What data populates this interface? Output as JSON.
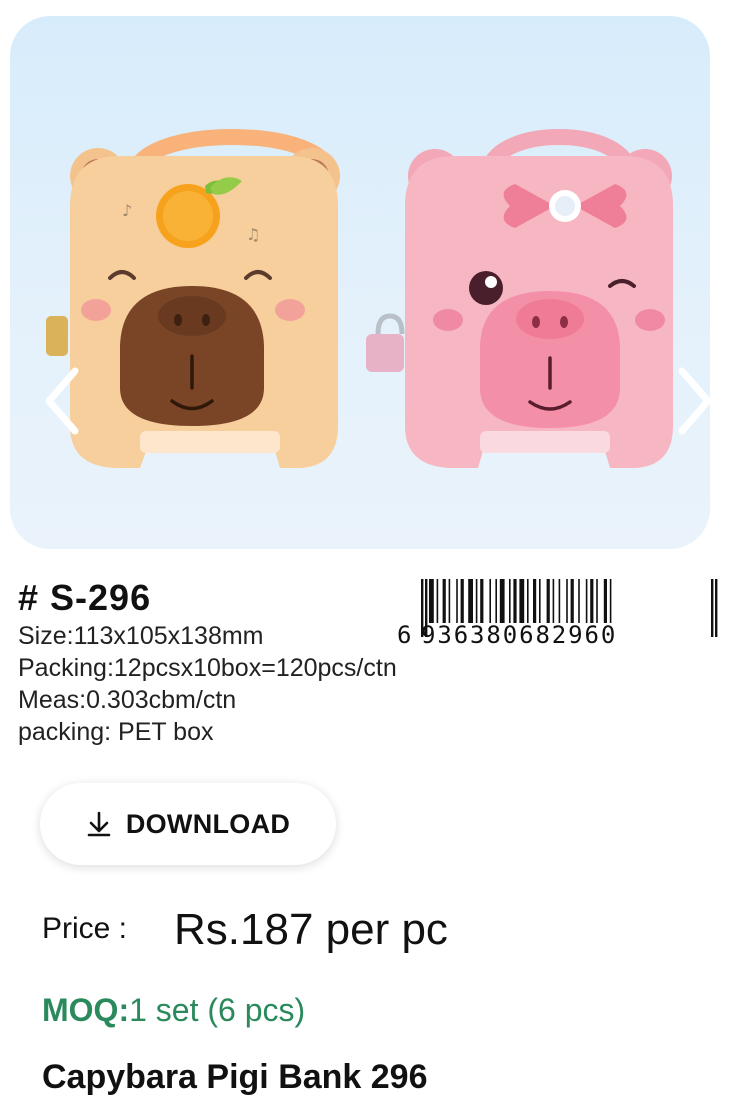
{
  "product": {
    "sku": "# S-296",
    "size": "Size:113x105x138mm",
    "packing_qty": "Packing:12pcsx10box=120pcs/ctn",
    "meas": "Meas:0.303cbm/ctn",
    "packing_type": "packing: PET box",
    "barcode": "6936380682960",
    "barcode_lead": "6",
    "barcode_rest": "936380682960",
    "name": "Capybara Pigi Bank 296"
  },
  "download": {
    "label": "DOWNLOAD",
    "icon": "download-arrow-icon"
  },
  "price": {
    "label": "Price :",
    "value": "Rs.187 per pc"
  },
  "moq": {
    "label": "MOQ:",
    "value": "1 set (6 pcs)"
  },
  "carousel": {
    "prev_icon": "chevron-left-icon",
    "next_icon": "chevron-right-icon"
  },
  "colors": {
    "card_bg": "#dcedfa",
    "moq_green": "#2a8a5c",
    "capybara_body": "#f7cf9c",
    "pig_body": "#f6b7c2"
  }
}
